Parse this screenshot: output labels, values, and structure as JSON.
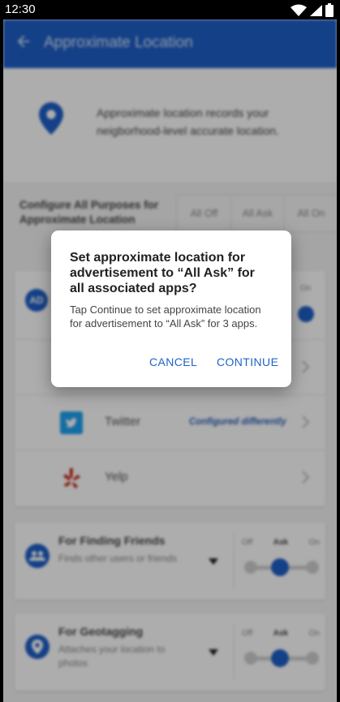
{
  "status_bar": {
    "time": "12:30"
  },
  "app_bar": {
    "title": "Approximate Location"
  },
  "info": {
    "text": "Approximate location records your neigborhood-level accurate location."
  },
  "config": {
    "label": "Configure All Purposes for Approximate Location",
    "options": [
      "All Off",
      "All Ask",
      "All On"
    ]
  },
  "purpose_card": {
    "icon_text": "AD",
    "on_label": "On",
    "apps": [
      {
        "name": "",
        "status": ""
      },
      {
        "name": "Twitter",
        "status": "Configured differently"
      },
      {
        "name": "Yelp",
        "status": ""
      }
    ]
  },
  "purposes": [
    {
      "title": "For Finding Friends",
      "subtitle": "Finds other users or friends",
      "labels": [
        "Off",
        "Ask",
        "On"
      ],
      "selected": "Ask"
    },
    {
      "title": "For Geotagging",
      "subtitle": "Attaches your location to photos",
      "labels": [
        "Off",
        "Ask",
        "On"
      ],
      "selected": "Ask"
    }
  ],
  "dialog": {
    "title": "Set approximate location for advertisement to “All Ask” for all associated apps?",
    "body": "Tap Continue to set approximate location for advertisement to “All Ask” for 3 apps.",
    "cancel": "CANCEL",
    "continue": "CONTINUE"
  },
  "colors": {
    "accent": "#1e5fc8",
    "twitter": "#1da1f2",
    "yelp": "#c41200"
  }
}
